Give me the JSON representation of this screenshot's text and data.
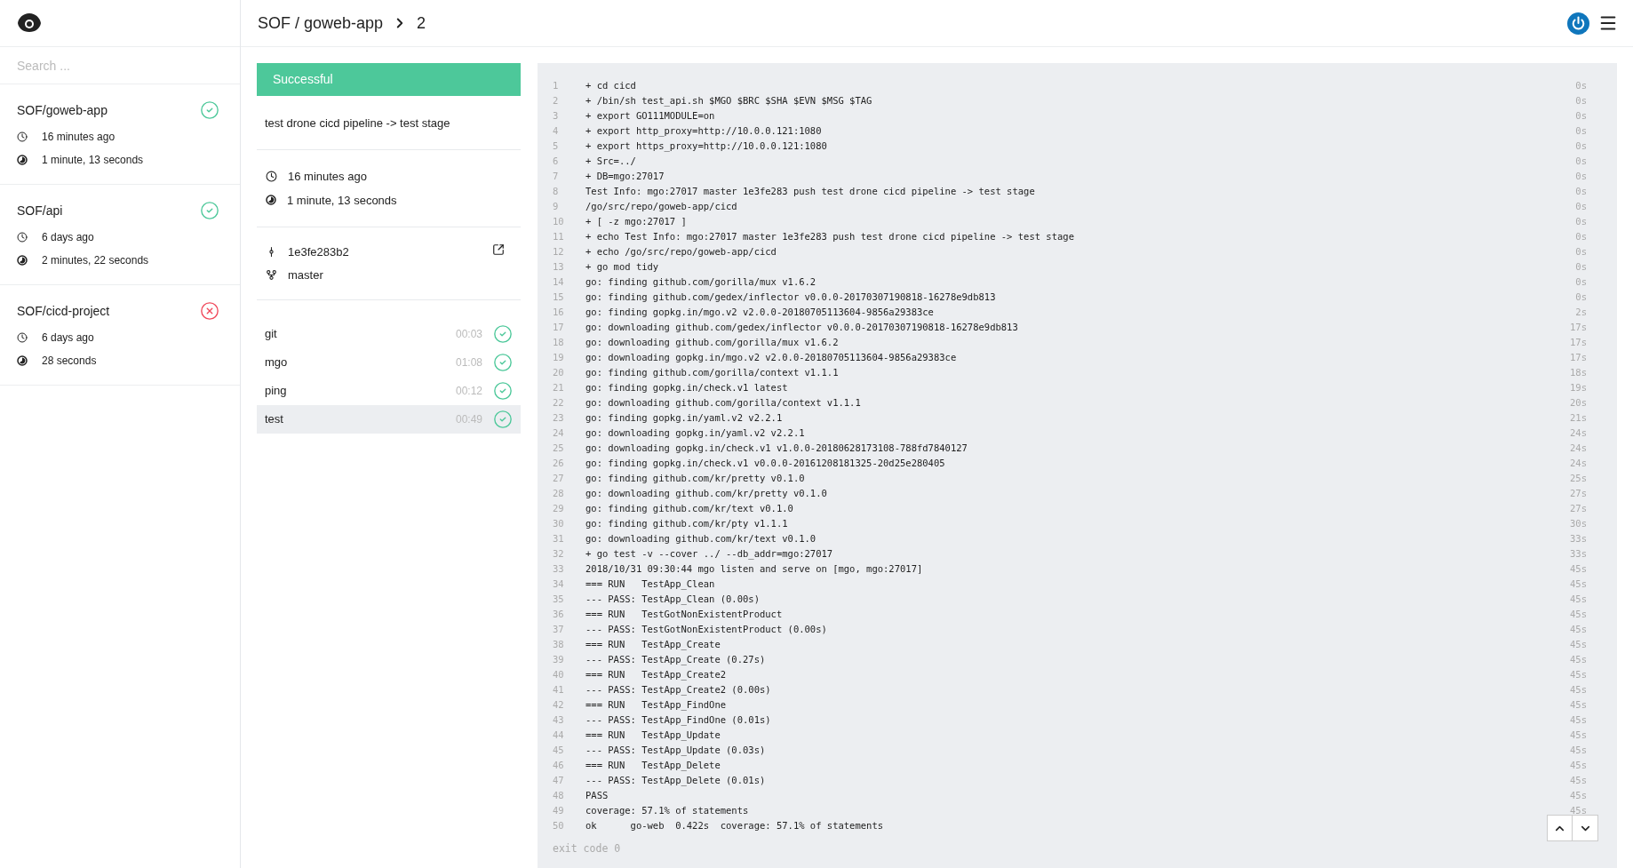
{
  "header": {
    "breadcrumb": "SOF / goweb-app",
    "build_number": "2"
  },
  "search": {
    "placeholder": "Search ..."
  },
  "repos": [
    {
      "name": "SOF/goweb-app",
      "kind": "success",
      "started": "16 minutes ago",
      "duration": "1 minute, 13 seconds"
    },
    {
      "name": "SOF/api",
      "kind": "success",
      "started": "6 days ago",
      "duration": "2 minutes, 22 seconds"
    },
    {
      "name": "SOF/cicd-project",
      "kind": "failure",
      "started": "6 days ago",
      "duration": "28 seconds"
    }
  ],
  "build": {
    "kind": "success",
    "status_label": "Successful",
    "message": "test drone cicd pipeline -> test stage",
    "started": "16 minutes ago",
    "duration": "1 minute, 13 seconds",
    "commit": "1e3fe283b2",
    "branch": "master"
  },
  "stages": [
    {
      "name": "git",
      "time": "00:03",
      "kind": "success",
      "selected": false
    },
    {
      "name": "mgo",
      "time": "01:08",
      "kind": "success",
      "selected": false
    },
    {
      "name": "ping",
      "time": "00:12",
      "kind": "success",
      "selected": false
    },
    {
      "name": "test",
      "time": "00:49",
      "kind": "success",
      "selected": true
    }
  ],
  "log": {
    "lines": [
      {
        "number": "1",
        "text": "+ cd cicd",
        "time": "0s"
      },
      {
        "number": "2",
        "text": "+ /bin/sh test_api.sh $MGO $BRC $SHA $EVN $MSG $TAG",
        "time": "0s"
      },
      {
        "number": "3",
        "text": "+ export GO111MODULE=on",
        "time": "0s"
      },
      {
        "number": "4",
        "text": "+ export http_proxy=http://10.0.0.121:1080",
        "time": "0s"
      },
      {
        "number": "5",
        "text": "+ export https_proxy=http://10.0.0.121:1080",
        "time": "0s"
      },
      {
        "number": "6",
        "text": "+ Src=../",
        "time": "0s"
      },
      {
        "number": "7",
        "text": "+ DB=mgo:27017",
        "time": "0s"
      },
      {
        "number": "8",
        "text": "Test Info: mgo:27017 master 1e3fe283 push test drone cicd pipeline -> test stage",
        "time": "0s"
      },
      {
        "number": "9",
        "text": "/go/src/repo/goweb-app/cicd",
        "time": "0s"
      },
      {
        "number": "10",
        "text": "+ [ -z mgo:27017 ]",
        "time": "0s"
      },
      {
        "number": "11",
        "text": "+ echo Test Info: mgo:27017 master 1e3fe283 push test drone cicd pipeline -> test stage",
        "time": "0s"
      },
      {
        "number": "12",
        "text": "+ echo /go/src/repo/goweb-app/cicd",
        "time": "0s"
      },
      {
        "number": "13",
        "text": "+ go mod tidy",
        "time": "0s"
      },
      {
        "number": "14",
        "text": "go: finding github.com/gorilla/mux v1.6.2",
        "time": "0s"
      },
      {
        "number": "15",
        "text": "go: finding github.com/gedex/inflector v0.0.0-20170307190818-16278e9db813",
        "time": "0s"
      },
      {
        "number": "16",
        "text": "go: finding gopkg.in/mgo.v2 v2.0.0-20180705113604-9856a29383ce",
        "time": "2s"
      },
      {
        "number": "17",
        "text": "go: downloading github.com/gedex/inflector v0.0.0-20170307190818-16278e9db813",
        "time": "17s"
      },
      {
        "number": "18",
        "text": "go: downloading github.com/gorilla/mux v1.6.2",
        "time": "17s"
      },
      {
        "number": "19",
        "text": "go: downloading gopkg.in/mgo.v2 v2.0.0-20180705113604-9856a29383ce",
        "time": "17s"
      },
      {
        "number": "20",
        "text": "go: finding github.com/gorilla/context v1.1.1",
        "time": "18s"
      },
      {
        "number": "21",
        "text": "go: finding gopkg.in/check.v1 latest",
        "time": "19s"
      },
      {
        "number": "22",
        "text": "go: downloading github.com/gorilla/context v1.1.1",
        "time": "20s"
      },
      {
        "number": "23",
        "text": "go: finding gopkg.in/yaml.v2 v2.2.1",
        "time": "21s"
      },
      {
        "number": "24",
        "text": "go: downloading gopkg.in/yaml.v2 v2.2.1",
        "time": "24s"
      },
      {
        "number": "25",
        "text": "go: downloading gopkg.in/check.v1 v1.0.0-20180628173108-788fd7840127",
        "time": "24s"
      },
      {
        "number": "26",
        "text": "go: finding gopkg.in/check.v1 v0.0.0-20161208181325-20d25e280405",
        "time": "24s"
      },
      {
        "number": "27",
        "text": "go: finding github.com/kr/pretty v0.1.0",
        "time": "25s"
      },
      {
        "number": "28",
        "text": "go: downloading github.com/kr/pretty v0.1.0",
        "time": "27s"
      },
      {
        "number": "29",
        "text": "go: finding github.com/kr/text v0.1.0",
        "time": "27s"
      },
      {
        "number": "30",
        "text": "go: finding github.com/kr/pty v1.1.1",
        "time": "30s"
      },
      {
        "number": "31",
        "text": "go: downloading github.com/kr/text v0.1.0",
        "time": "33s"
      },
      {
        "number": "32",
        "text": "+ go test -v --cover ../ --db_addr=mgo:27017",
        "time": "33s"
      },
      {
        "number": "33",
        "text": "2018/10/31 09:30:44 mgo listen and serve on [mgo, mgo:27017]",
        "time": "45s"
      },
      {
        "number": "34",
        "text": "=== RUN   TestApp_Clean",
        "time": "45s"
      },
      {
        "number": "35",
        "text": "--- PASS: TestApp_Clean (0.00s)",
        "time": "45s"
      },
      {
        "number": "36",
        "text": "=== RUN   TestGotNonExistentProduct",
        "time": "45s"
      },
      {
        "number": "37",
        "text": "--- PASS: TestGotNonExistentProduct (0.00s)",
        "time": "45s"
      },
      {
        "number": "38",
        "text": "=== RUN   TestApp_Create",
        "time": "45s"
      },
      {
        "number": "39",
        "text": "--- PASS: TestApp_Create (0.27s)",
        "time": "45s"
      },
      {
        "number": "40",
        "text": "=== RUN   TestApp_Create2",
        "time": "45s"
      },
      {
        "number": "41",
        "text": "--- PASS: TestApp_Create2 (0.00s)",
        "time": "45s"
      },
      {
        "number": "42",
        "text": "=== RUN   TestApp_FindOne",
        "time": "45s"
      },
      {
        "number": "43",
        "text": "--- PASS: TestApp_FindOne (0.01s)",
        "time": "45s"
      },
      {
        "number": "44",
        "text": "=== RUN   TestApp_Update",
        "time": "45s"
      },
      {
        "number": "45",
        "text": "--- PASS: TestApp_Update (0.03s)",
        "time": "45s"
      },
      {
        "number": "46",
        "text": "=== RUN   TestApp_Delete",
        "time": "45s"
      },
      {
        "number": "47",
        "text": "--- PASS: TestApp_Delete (0.01s)",
        "time": "45s"
      },
      {
        "number": "48",
        "text": "PASS",
        "time": "45s"
      },
      {
        "number": "49",
        "text": "coverage: 57.1% of statements",
        "time": "45s"
      },
      {
        "number": "50",
        "text": "ok      go-web  0.422s  coverage: 57.1% of statements"
      }
    ],
    "exit_code": "exit code 0"
  }
}
